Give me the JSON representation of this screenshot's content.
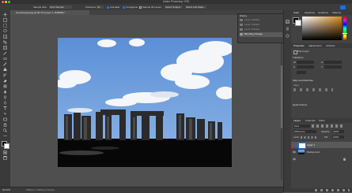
{
  "window": {
    "title": "Adobe Photoshop 2025"
  },
  "options_bar": {
    "sample_size_label": "Sample Size:",
    "sample_size_value": "Point Sample",
    "tolerance_label": "Tolerance:",
    "tolerance_value": "32",
    "anti_alias": "Anti-alias",
    "contiguous": "Contiguous",
    "sample_all_layers": "Sample All Layers",
    "select_subject": "Select Subject",
    "select_and_mask": "Select and Mask..."
  },
  "document": {
    "tab_title": "stonehenge.jpeg @ 66.7% (Layer 1, RGB/8#) *"
  },
  "status_bar": {
    "zoom": "66.67%",
    "doc_info": "1650 px x 1260 px (72 ppi)"
  },
  "history_panel": {
    "title": "History",
    "items": [
      "Layer Visibility",
      "Layer Visibility",
      "Layer Visibility",
      "Blending Change"
    ]
  },
  "top_right_tabs": [
    "Color",
    "Swatches",
    "Gradients",
    "Patterns"
  ],
  "properties_panel": {
    "tabs": [
      "Properties",
      "Adjustments",
      "Libraries"
    ],
    "layer_type": "Pixel Layer",
    "transform_label": "Transform",
    "w_label": "W",
    "h_label": "H",
    "x_label": "X",
    "y_label": "Y",
    "align_label": "Align and Distribute",
    "align_sub": "Align:",
    "quick_actions_label": "Quick Actions"
  },
  "layers_panel": {
    "tabs": [
      "Layers",
      "Channels",
      "Paths"
    ],
    "kind_label": "Kind",
    "blend_mode": "Difference",
    "opacity_label": "Opacity:",
    "opacity_value": "100%",
    "lock_label": "Lock:",
    "fill_label": "Fill:",
    "fill_value": "100%",
    "layers": [
      {
        "name": "Layer 1",
        "selected": true
      },
      {
        "name": "Background",
        "selected": false
      }
    ]
  },
  "colors": {
    "accent": "#1473e6",
    "swatch_fg": "#b7752e",
    "sky": "#6f9cd8"
  }
}
